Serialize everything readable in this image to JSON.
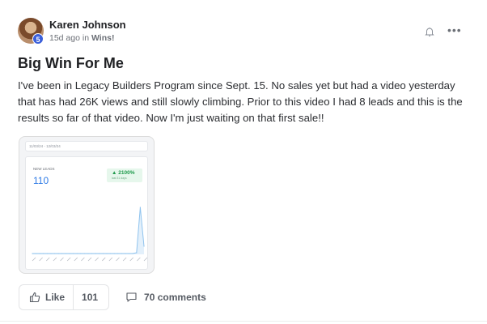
{
  "post": {
    "author": "Karen Johnson",
    "level": "5",
    "time_ago": "15d ago in ",
    "category": "Wins!",
    "title": "Big Win For Me",
    "body": "I've been in Legacy Builders Program since Sept. 15. No sales yet but had a video yesterday that has had 26K views and still slowly climbing. Prior to this video I had 8 leads and this is the results so far of that video. Now I'm just waiting on that first sale!!"
  },
  "header_icons": {
    "bell": "bell-icon",
    "more": "•••"
  },
  "image": {
    "date_range": "11/03/24 - 12/03/24",
    "leads_label": "NEW LEADS",
    "leads_value": "110",
    "change": "▲ 2100%",
    "change_sub": "last 31 days",
    "chart_data": {
      "type": "area",
      "series": [
        {
          "values": [
            1,
            1,
            1,
            1,
            1,
            1,
            1,
            1,
            1,
            1,
            1,
            1,
            1,
            1,
            1,
            1,
            1,
            1,
            1,
            1,
            1,
            1,
            1,
            1,
            1,
            1,
            1,
            1,
            2,
            58,
            10
          ]
        }
      ],
      "ylim": [
        0,
        80
      ],
      "grid": false
    },
    "colors": {
      "line": "#8fc3ee",
      "fill": "#e3f0fb",
      "accent": "#2f7be6",
      "positive": "#1e9a4b"
    }
  },
  "actions": {
    "like_label": "Like",
    "like_count": "101",
    "comments_label": "70 comments"
  }
}
